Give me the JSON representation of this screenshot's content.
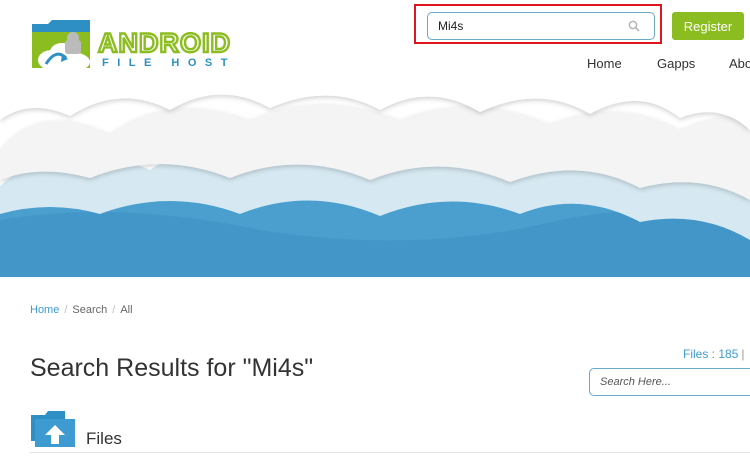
{
  "header": {
    "logo": {
      "word1": "ANDROID",
      "word2": "FILE HOST"
    },
    "search": {
      "value": "Mi4s"
    },
    "register_label": "Register",
    "nav": [
      {
        "label": "Home"
      },
      {
        "label": "Gapps"
      },
      {
        "label": "Abo"
      }
    ]
  },
  "breadcrumb": {
    "home": "Home",
    "sep1": "/",
    "search": "Search",
    "sep2": "/",
    "all": "All"
  },
  "results": {
    "title": "Search Results for \"Mi4s\"",
    "files_count": "Files : 185",
    "pipe": "|",
    "side_search_placeholder": "Search Here...",
    "section_label": "Files"
  },
  "colors": {
    "accent_green": "#8cbd20",
    "link_blue": "#3d9bd1",
    "highlight_red": "#e0161f",
    "hero_blue": "#4a9fcf"
  },
  "icons": {
    "search": "search-icon",
    "folder": "folder-upload-icon",
    "logo": "android-cloud-logo"
  }
}
